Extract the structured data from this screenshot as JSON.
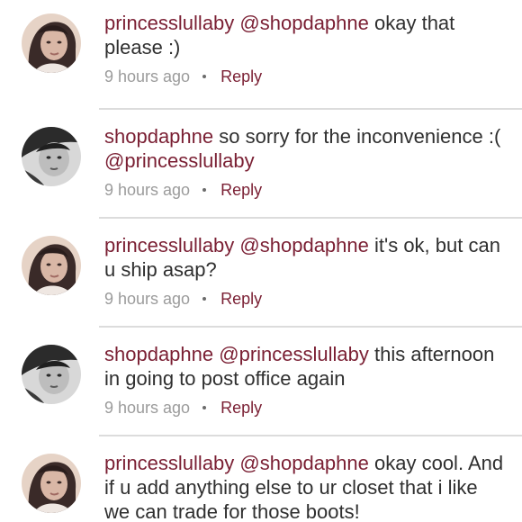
{
  "comments": [
    {
      "avatar": "princess-avatar",
      "username": "princesslullaby",
      "mention": "@shopdaphne",
      "text": "okay that please :)",
      "time": "9 hours ago",
      "reply_label": "Reply"
    },
    {
      "avatar": "shop-avatar",
      "username": "shopdaphne",
      "text": "so sorry for the inconvenience :(",
      "mention_after": "@princesslullaby",
      "time": "9 hours ago",
      "reply_label": "Reply"
    },
    {
      "avatar": "princess-avatar",
      "username": "princesslullaby",
      "mention": "@shopdaphne",
      "text": "it's ok,  but can u ship asap?",
      "time": "9 hours ago",
      "reply_label": "Reply"
    },
    {
      "avatar": "shop-avatar",
      "username": "shopdaphne",
      "mention": "@princesslullaby",
      "text": "this afternoon in going to post office again",
      "time": "9 hours ago",
      "reply_label": "Reply"
    },
    {
      "avatar": "princess-avatar",
      "username": "princesslullaby",
      "mention": "@shopdaphne",
      "text": "okay cool. And if u add anything else to ur closet that i like we can trade for those boots!",
      "time": "",
      "reply_label": ""
    }
  ],
  "colors": {
    "username": "#7a1f33",
    "text": "#2f2f2f",
    "meta": "#9b9b9b",
    "divider": "#dcdcdc"
  }
}
